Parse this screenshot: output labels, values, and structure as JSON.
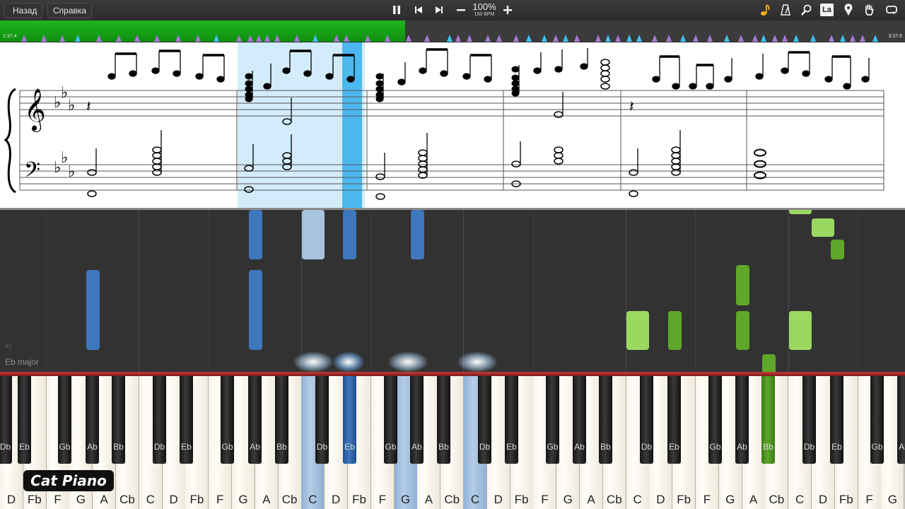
{
  "toolbar": {
    "back_label": "Назад",
    "help_label": "Справка",
    "zoom": "100%",
    "bpm": "150 BPM",
    "la_label": "La",
    "icons": [
      "pause-icon",
      "skip-back-icon",
      "skip-forward-icon",
      "minus-icon",
      "plus-icon",
      "note-icon",
      "metronome-icon",
      "magnifier-icon",
      "pin-icon",
      "hand-icon",
      "loop-icon"
    ]
  },
  "timeline": {
    "elapsed": "1:37.4",
    "total": "3:37.6",
    "played_percent": 44.8
  },
  "roll": {
    "key_signature": "Eb major",
    "row_number": "62"
  },
  "keyboard": {
    "white_keys": [
      "D",
      "Fb",
      "F",
      "G",
      "A",
      "Cb",
      "C",
      "D",
      "Fb",
      "F",
      "G",
      "A",
      "Cb",
      "C",
      "D",
      "Fb",
      "F",
      "G",
      "A",
      "Cb",
      "C",
      "D",
      "Fb",
      "F",
      "G",
      "A",
      "Cb",
      "C",
      "D",
      "Fb",
      "F",
      "G",
      "A",
      "Cb",
      "C",
      "D",
      "Fb",
      "F",
      "G"
    ],
    "black_keys": [
      "Db",
      "Eb",
      "Gb",
      "Ab",
      "Bb",
      "Db",
      "Eb",
      "Gb",
      "Ab",
      "Bb",
      "Db",
      "Eb",
      "Gb",
      "Ab",
      "Bb",
      "Db",
      "Eb",
      "Gb",
      "Ab",
      "Bb",
      "Db",
      "Eb",
      "Gb",
      "Ab",
      "Bb",
      "Db",
      "Eb",
      "Gb",
      "Ab",
      "Bb",
      "Db",
      "Eb",
      "Gb",
      "Ab"
    ]
  },
  "watermark": "Cat Piano",
  "colors": {
    "played_timeline": "#18a318",
    "right_hand_blue": "#3f77bd",
    "left_hand_green": "#5ea72a",
    "highlight_cyan": "#4cb8ee"
  }
}
